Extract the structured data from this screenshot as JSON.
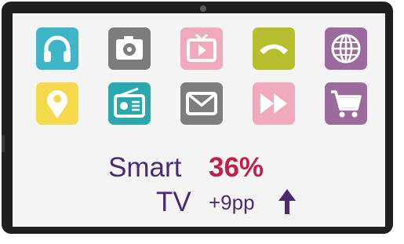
{
  "stat": {
    "line1": "Smart",
    "line2": "TV",
    "value": "36%",
    "change": "+9pp"
  },
  "colors": {
    "label": "#4a2c6e",
    "value": "#c21f4a",
    "arrow": "#4a2c6e"
  },
  "icons": [
    {
      "name": "headphones-icon",
      "color": "#3fb6c8"
    },
    {
      "name": "camera-icon",
      "color": "#7d7d7d"
    },
    {
      "name": "tv-play-icon",
      "color": "#f0a9bd"
    },
    {
      "name": "phone-icon",
      "color": "#b5bf2e"
    },
    {
      "name": "globe-icon",
      "color": "#9b6b9e"
    },
    {
      "name": "location-pin-icon",
      "color": "#f3d94b"
    },
    {
      "name": "radio-icon",
      "color": "#2aa8ad"
    },
    {
      "name": "mail-icon",
      "color": "#7d7d7d"
    },
    {
      "name": "fast-forward-icon",
      "color": "#f0a9bd"
    },
    {
      "name": "shopping-cart-icon",
      "color": "#9b6b9e"
    }
  ]
}
